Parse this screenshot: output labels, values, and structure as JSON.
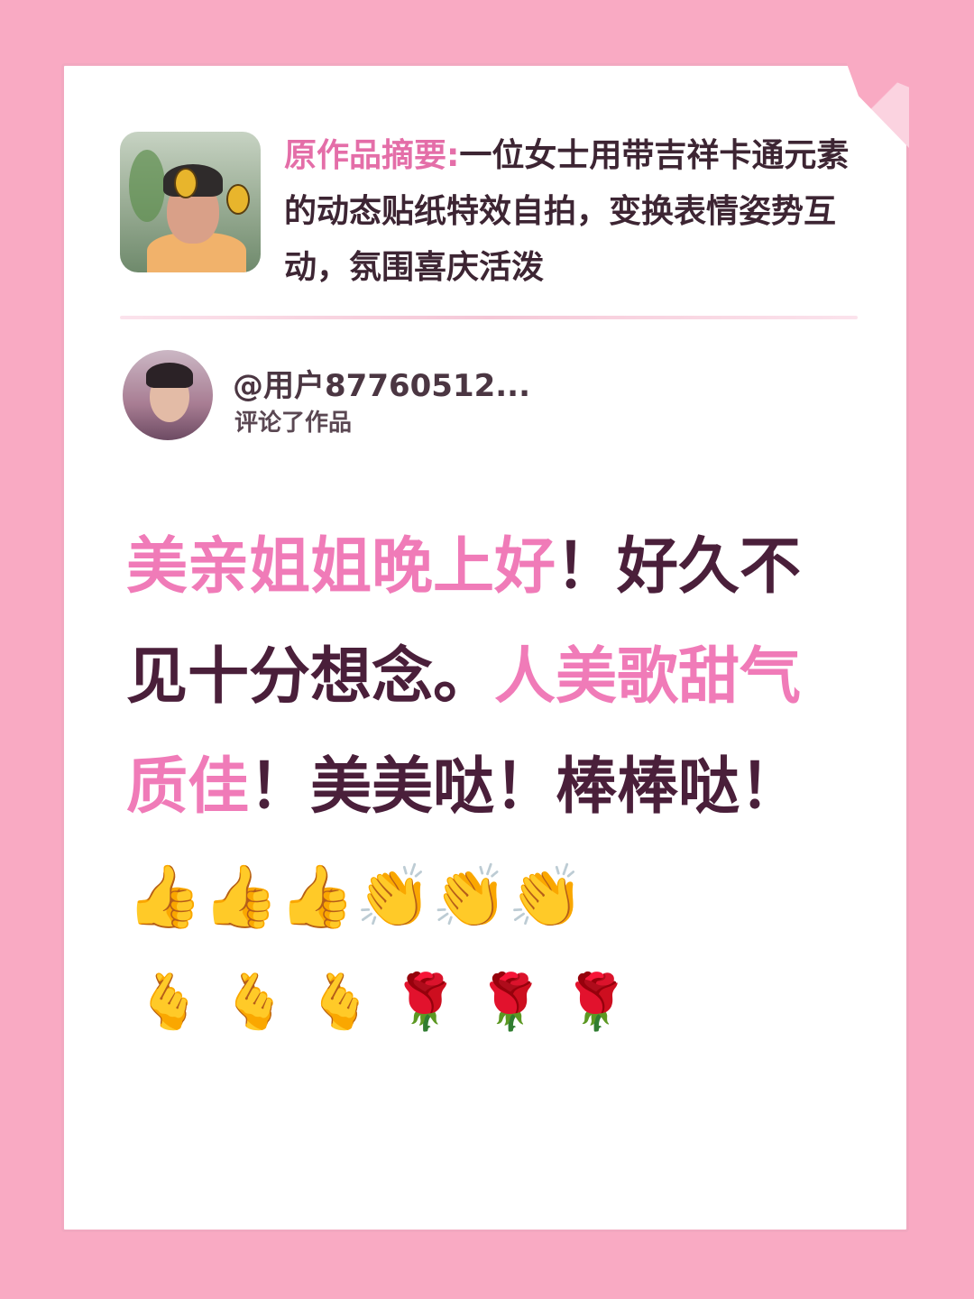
{
  "summary": {
    "label": "原作品摘要:",
    "text": "一位女士用带吉祥卡通元素的动态贴纸特效自拍，变换表情姿势互动，氛围喜庆活泼"
  },
  "commenter": {
    "username": "@用户87760512...",
    "action": "评论了作品"
  },
  "comment": {
    "part1": "美亲姐姐晚上好",
    "part2": "！好久不见十分想念。",
    "part3": "人美歌甜气质佳",
    "part4": "！美美哒！棒棒哒！",
    "emoji_inline": [
      "👍",
      "👍",
      "👍",
      "👏",
      "👏",
      "👏"
    ],
    "emoji_row": [
      "🫰",
      "🫰",
      "🫰",
      "🌹",
      "🌹",
      "🌹"
    ]
  },
  "colors": {
    "background": "#f9aac3",
    "accent_pink": "#f07bb8",
    "dark_text": "#4a1f3a"
  }
}
